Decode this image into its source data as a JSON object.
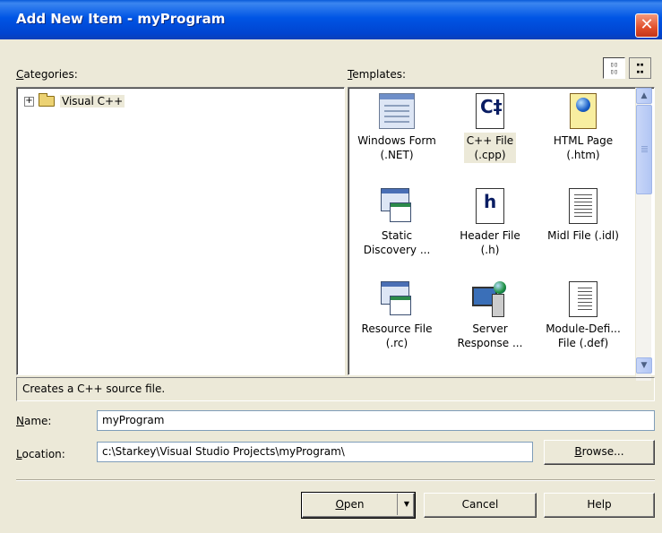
{
  "window": {
    "title": "Add New Item - myProgram",
    "close_glyph": "✕"
  },
  "categories": {
    "label_mnemonic": "C",
    "label_rest": "ategories:",
    "tree": [
      {
        "label": "Visual C++",
        "expander": "+",
        "icon": "folder-icon"
      }
    ]
  },
  "templates": {
    "label_mnemonic": "T",
    "label_rest": "emplates:",
    "view_buttons": [
      {
        "name": "large-icons",
        "glyph": "▯▯\n▯▯",
        "active": true
      },
      {
        "name": "small-icons",
        "glyph": "▪▪\n▪▪",
        "active": false
      }
    ],
    "items": [
      {
        "line1": "Windows Form",
        "line2": "(.NET)",
        "icon": "windows-form-icon"
      },
      {
        "line1": "C++ File",
        "line2": "(.cpp)",
        "icon": "cpp-file-icon",
        "selected": true,
        "icon_text": "C‡"
      },
      {
        "line1": "HTML Page",
        "line2": "(.htm)",
        "icon": "html-page-icon"
      },
      {
        "line1": "Static",
        "line2": "Discovery ...",
        "icon": "static-discovery-icon"
      },
      {
        "line1": "Header File",
        "line2": "(.h)",
        "icon": "header-file-icon",
        "icon_text": "h"
      },
      {
        "line1": "Midl File (.idl)",
        "line2": "",
        "icon": "midl-file-icon"
      },
      {
        "line1": "Resource File",
        "line2": "(.rc)",
        "icon": "resource-file-icon"
      },
      {
        "line1": "Server",
        "line2": "Response ...",
        "icon": "server-response-icon"
      },
      {
        "line1": "Module-Defi...",
        "line2": "File (.def)",
        "icon": "module-definition-icon"
      }
    ],
    "scroll_up": "▲",
    "scroll_down": "▼"
  },
  "description": "Creates a C++ source file.",
  "name_field": {
    "label_mnemonic": "N",
    "label_rest": "ame:",
    "value": "myProgram"
  },
  "location_field": {
    "label_mnemonic": "L",
    "label_rest": "ocation:",
    "value": "c:\\Starkey\\Visual Studio Projects\\myProgram\\"
  },
  "buttons": {
    "browse_mnemonic": "B",
    "browse_rest": "rowse...",
    "open_mnemonic": "O",
    "open_rest": "pen",
    "open_arrow": "▼",
    "cancel": "Cancel",
    "help": "Help"
  }
}
